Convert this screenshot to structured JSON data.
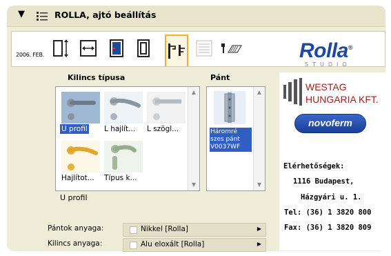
{
  "header": {
    "title": "ROLLA, ajtó beállítás"
  },
  "toolbar": {
    "date": "2006. FEB.",
    "buttons": [
      "door-width-icon",
      "door-height-icon",
      "door-front-icon",
      "door-frame-icon",
      "handle-icon",
      "list-icon",
      "hinge-icon"
    ],
    "active": "handle-icon"
  },
  "brand": {
    "rolla": "Rolla",
    "studio": "STUDIO"
  },
  "handles": {
    "label": "Kilincs típusa",
    "items": [
      "U profil",
      "L hajlít...",
      "L szögl...",
      "Hajlítot...",
      "Típus k..."
    ],
    "selected": "U profil",
    "selected_text": "U profil"
  },
  "hinge": {
    "label": "Pánt",
    "items": [
      "Háromré szes pánt V0037WF"
    ]
  },
  "materials": {
    "hinge_label": "Pántok anyaga:",
    "hinge_value": "Nikkel [Rolla]",
    "handle_label": "Kilincs anyaga:",
    "handle_value": "Alu eloxált [Rolla]"
  },
  "sponsor": {
    "westag_line1": "WESTAG",
    "westag_line2": "HUNGARIA KFT.",
    "novoferm": "novoferm"
  },
  "contact": {
    "title": "Elérhetőségek:",
    "line1": "1116 Budapest,",
    "line2": "Házgyári u. 1.",
    "tel": "Tel:  (36) 1 3820 800",
    "fax": "Fax:  (36) 1 3820 809"
  },
  "colors": {
    "selection": "#315ec4",
    "accent": "#f2b030",
    "brand": "#1d4a9e"
  }
}
